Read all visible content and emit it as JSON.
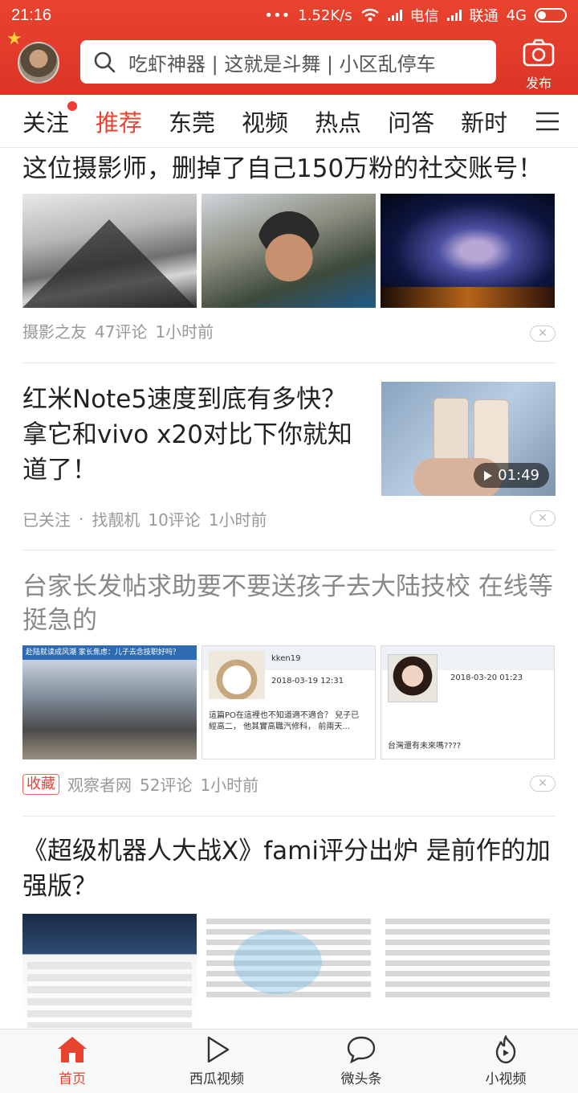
{
  "status_bar": {
    "time": "21:16",
    "dots": "•••",
    "speed": "1.52K/s",
    "carrier1": "电信",
    "carrier2": "联通",
    "network": "4G"
  },
  "header": {
    "search_placeholder": "吃虾神器 | 这就是斗舞 | 小区乱停车",
    "publish_label": "发布",
    "colors": {
      "background": "#e8432e"
    }
  },
  "tabs": [
    {
      "label": "关注",
      "has_dot": true
    },
    {
      "label": "推荐",
      "active": true
    },
    {
      "label": "东莞"
    },
    {
      "label": "视频"
    },
    {
      "label": "热点"
    },
    {
      "label": "问答"
    },
    {
      "label": "新时"
    }
  ],
  "feed": {
    "articles": [
      {
        "title": "这位摄影师，删掉了自己150万粉的社交账号！",
        "source": "摄影之友",
        "comments": "47评论",
        "time": "1小时前"
      },
      {
        "title": "红米Note5速度到底有多快？拿它和vivo x20对比下你就知道了！",
        "followed": "已关注",
        "separator": "·",
        "source": "找靓机",
        "comments": "10评论",
        "time": "1小时前",
        "duration": "01:49"
      },
      {
        "title": "台家长发帖求助要不要送孩子去大陆技校 在线等挺急的",
        "tag": "收藏",
        "source": "观察者网",
        "comments": "52评论",
        "time": "1小时前",
        "thumb_texts": {
          "banner": "赴陆就读成风潮 家长焦虑：儿子去念技职好吗？",
          "user1": "kken19",
          "date1": "2018-03-19 12:31",
          "post1": "這篇PO在這裡也不知道適不適合？ 兒子已經高二， 他其實高職汽修科， 前兩天...",
          "date2": "2018-03-20 01:23",
          "post2": "台灣還有未來嗎????"
        }
      },
      {
        "title": "《超级机器人大战X》fami评分出炉 是前作的加强版？"
      }
    ]
  },
  "bottom_nav": [
    {
      "label": "首页",
      "icon": "home-icon",
      "active": true
    },
    {
      "label": "西瓜视频",
      "icon": "play-icon"
    },
    {
      "label": "微头条",
      "icon": "chat-bubble-icon"
    },
    {
      "label": "小视频",
      "icon": "flame-play-icon"
    }
  ]
}
